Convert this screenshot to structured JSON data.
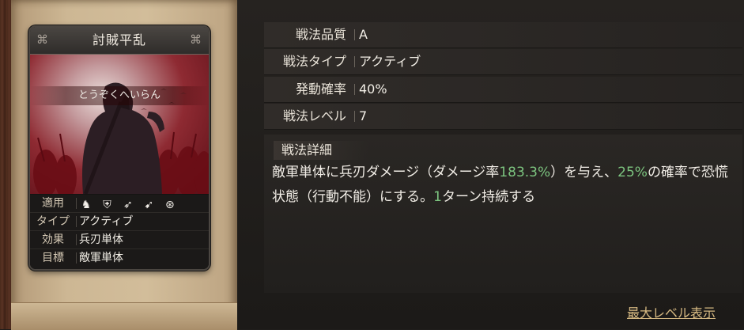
{
  "card": {
    "name": "討賊平乱",
    "reading": "とうぞくへいらん",
    "rows": {
      "apply_label": "適用",
      "type_label": "タイプ",
      "type_value": "アクティブ",
      "effect_label": "効果",
      "effect_value": "兵刃単体",
      "target_label": "目標",
      "target_value": "敵軍単体"
    },
    "apply_icons": [
      "cavalry-icon",
      "shield-icon",
      "bow-icon",
      "spear-icon",
      "wheel-icon"
    ]
  },
  "stats": [
    {
      "label": "戦法品質",
      "value": "A"
    },
    {
      "label": "戦法タイプ",
      "value": "アクティブ"
    },
    {
      "label": "発動確率",
      "value": "40%"
    },
    {
      "label": "戦法レベル",
      "value": "7"
    }
  ],
  "detail": {
    "heading": "戦法詳細",
    "t1": "敵軍単体に兵刃ダメージ（ダメージ率",
    "n1": "183.3%",
    "t2": "）を与え、",
    "n2": "25%",
    "t3": "の確率で恐慌状態（行動不能）にする。",
    "n3": "1",
    "t4": "ターン持続する"
  },
  "max_level_link": "最大レベル表示",
  "colors": {
    "highlight": "#7cc47f",
    "link": "#d6b982"
  }
}
